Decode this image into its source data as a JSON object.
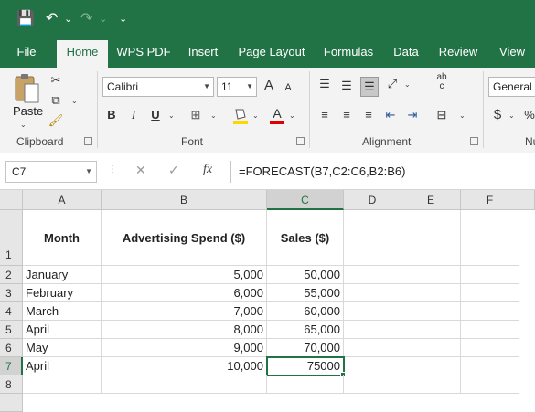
{
  "qat": {
    "save": "💾",
    "undo": "↶",
    "undo_dd": "⌄",
    "redo": "↷",
    "redo_dd": "⌄",
    "customize": "⌄"
  },
  "tabs": [
    "File",
    "Home",
    "WPS PDF",
    "Insert",
    "Page Layout",
    "Formulas",
    "Data",
    "Review",
    "View"
  ],
  "ribbon": {
    "clipboard": {
      "paste_label": "Paste",
      "group_label": "Clipboard"
    },
    "font": {
      "name": "Calibri",
      "size": "11",
      "grow": "A",
      "shrink": "A",
      "bold": "B",
      "italic": "I",
      "underline": "U",
      "font_color_letter": "A",
      "group_label": "Font"
    },
    "alignment": {
      "group_label": "Alignment",
      "wrap": "ab\nc"
    },
    "number": {
      "format": "General",
      "currency": "$",
      "percent": "%",
      "group_label": "Nu"
    }
  },
  "formula_bar": {
    "name_box": "C7",
    "cancel": "✕",
    "enter": "✓",
    "fx": "fx",
    "formula": "=FORECAST(B7,C2:C6,B2:B6)"
  },
  "columns": [
    "A",
    "B",
    "C",
    "D",
    "E",
    "F"
  ],
  "rows": [
    "1",
    "2",
    "3",
    "4",
    "5",
    "6",
    "7",
    "8"
  ],
  "sheet": {
    "headers": [
      "Month",
      "Advertising Spend ($)",
      "Sales ($)"
    ],
    "data": [
      [
        "January",
        "5,000",
        "50,000"
      ],
      [
        "February",
        "6,000",
        "55,000"
      ],
      [
        "March",
        "7,000",
        "60,000"
      ],
      [
        "April",
        "8,000",
        "65,000"
      ],
      [
        "May",
        "9,000",
        "70,000"
      ],
      [
        "April",
        "10,000",
        "75000"
      ]
    ]
  },
  "colors": {
    "brand": "#217346",
    "ribbon_bg": "#f3f3f3",
    "header_bg": "#e6e6e6"
  }
}
